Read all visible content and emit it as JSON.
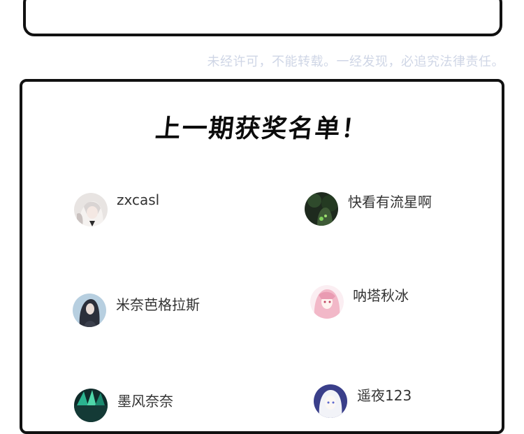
{
  "notice": "未经许可，不能转载。一经发现，必追究法律责任。",
  "title": "上一期获奖名单！",
  "winners": [
    {
      "name": "zxcasl",
      "avatar_icon": "anime-avatar-icon"
    },
    {
      "name": "快看有流星啊",
      "avatar_icon": "dark-forest-avatar-icon"
    },
    {
      "name": "米奈芭格拉斯",
      "avatar_icon": "dark-hair-girl-avatar-icon"
    },
    {
      "name": "呐塔秋冰",
      "avatar_icon": "pink-hair-avatar-icon"
    },
    {
      "name": "墨风奈奈",
      "avatar_icon": "green-crystal-avatar-icon"
    },
    {
      "name": "遥夜123",
      "avatar_icon": "white-hair-avatar-icon"
    }
  ]
}
